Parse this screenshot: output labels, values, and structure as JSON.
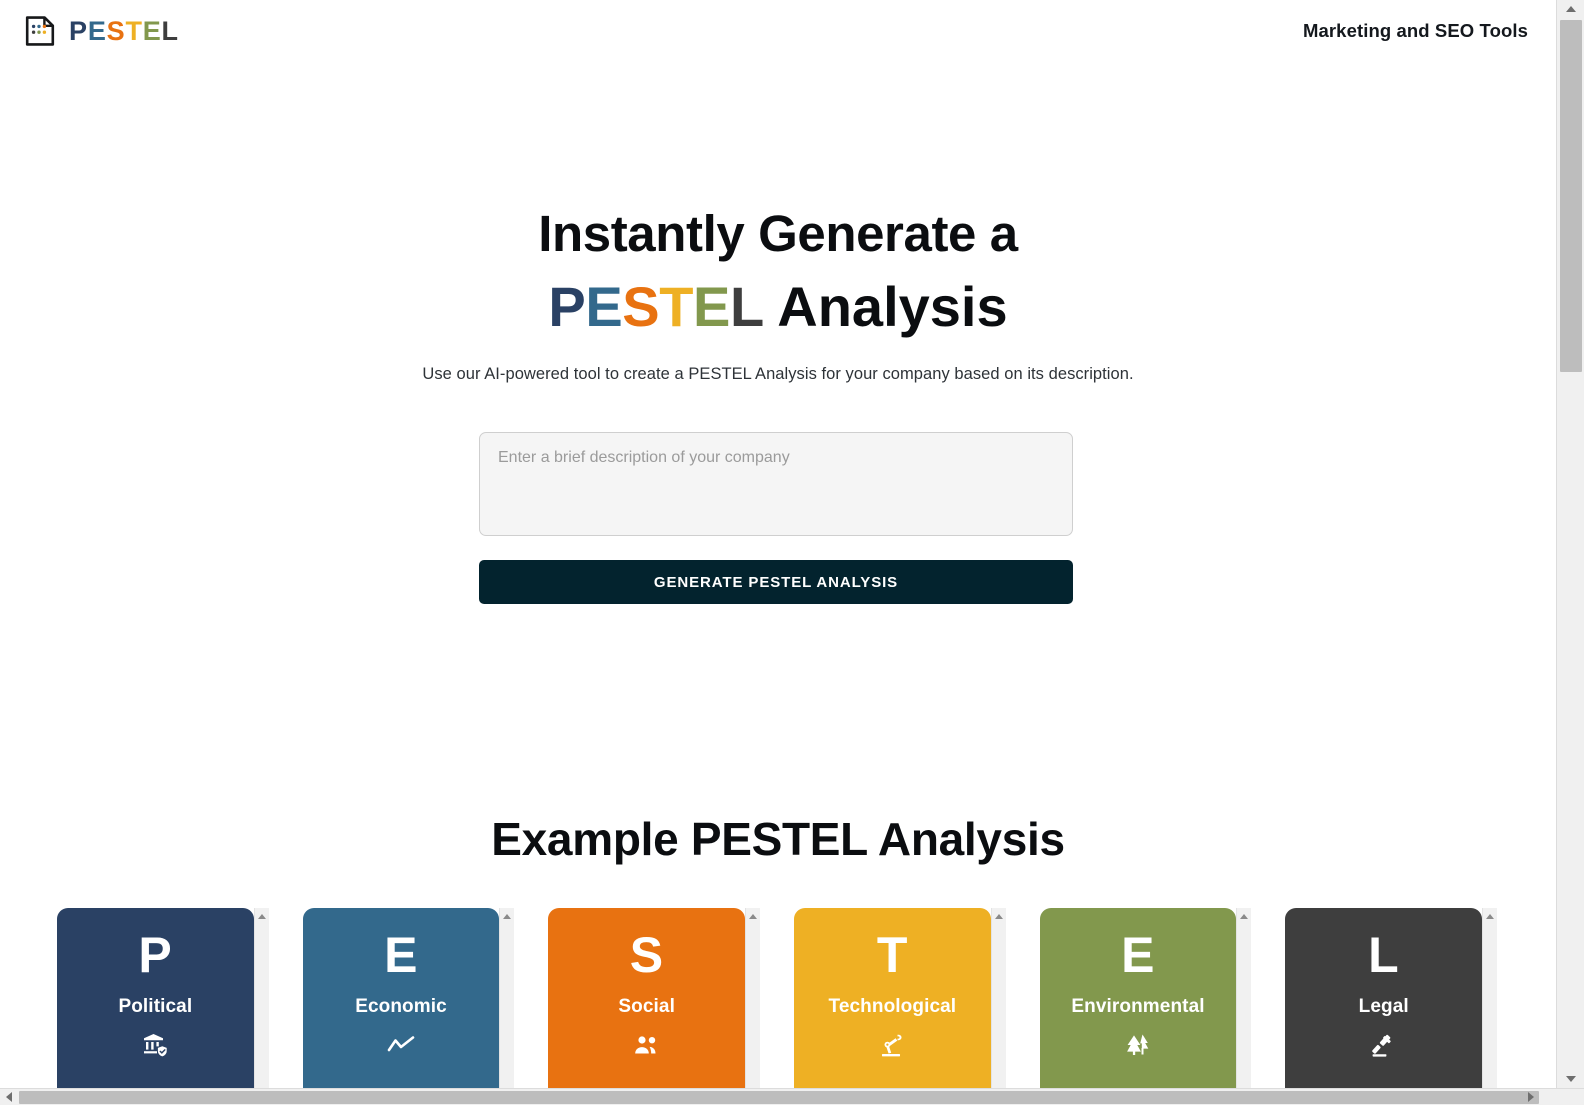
{
  "header": {
    "logo_icon": "pestel-document-icon",
    "brand_letters": [
      {
        "char": "P",
        "color": "#2a4164"
      },
      {
        "char": "E",
        "color": "#33698c"
      },
      {
        "char": "S",
        "color": "#e87211"
      },
      {
        "char": "T",
        "color": "#eeb024"
      },
      {
        "char": "E",
        "color": "#82984d"
      },
      {
        "char": "L",
        "color": "#3e3e3e"
      }
    ],
    "right_label": "Marketing and SEO Tools"
  },
  "hero": {
    "line1": "Instantly Generate a",
    "line2_colored": [
      {
        "char": "P",
        "color": "#2a4164"
      },
      {
        "char": "E",
        "color": "#33698c"
      },
      {
        "char": "S",
        "color": "#e87211"
      },
      {
        "char": "T",
        "color": "#eeb024"
      },
      {
        "char": "E",
        "color": "#82984d"
      },
      {
        "char": "L",
        "color": "#3e3e3e"
      }
    ],
    "line2_plain": " Analysis",
    "subtitle": "Use our AI-powered tool to create a PESTEL Analysis for your company based on its description."
  },
  "form": {
    "description_value": "",
    "description_placeholder": "Enter a brief description of your company",
    "generate_label": "GENERATE PESTEL ANALYSIS",
    "generate_color": "#03232e"
  },
  "example": {
    "heading": "Example PESTEL Analysis",
    "cards": [
      {
        "letter": "P",
        "title": "Political",
        "color": "#2a4164",
        "icon": "bank-shield-icon"
      },
      {
        "letter": "E",
        "title": "Economic",
        "color": "#33698c",
        "icon": "line-chart-icon"
      },
      {
        "letter": "S",
        "title": "Social",
        "color": "#e87211",
        "icon": "people-group-icon"
      },
      {
        "letter": "T",
        "title": "Technological",
        "color": "#eeb024",
        "icon": "robot-arm-icon"
      },
      {
        "letter": "E",
        "title": "Environmental",
        "color": "#82984d",
        "icon": "trees-icon"
      },
      {
        "letter": "L",
        "title": "Legal",
        "color": "#3e3e3e",
        "icon": "gavel-icon"
      }
    ]
  }
}
